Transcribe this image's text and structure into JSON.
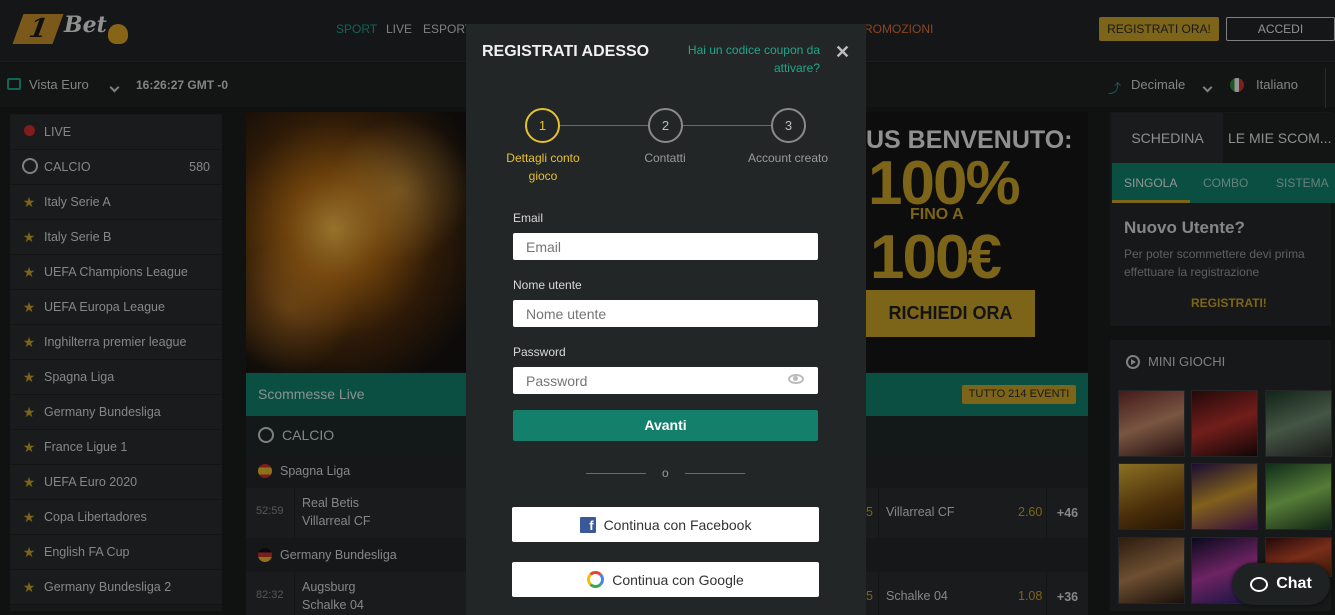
{
  "brand": {
    "logo_one": "1",
    "logo_text": "Bet"
  },
  "nav": {
    "items": [
      "SPORT",
      "LIVE",
      "ESPORTS"
    ],
    "promo": "ROMOZIONI",
    "register": "REGISTRATI ORA!",
    "login": "ACCEDI"
  },
  "subbar": {
    "view": "Vista Euro",
    "time": "16:26:27 GMT -0",
    "odds_format": "Decimale",
    "language": "Italiano"
  },
  "sidebar": {
    "items": [
      {
        "label": "LIVE",
        "icon": "live-dot-icon",
        "count": ""
      },
      {
        "label": "CALCIO",
        "icon": "soccer-ball-icon",
        "count": "580"
      },
      {
        "label": "Italy Serie A",
        "icon": "star-icon"
      },
      {
        "label": "Italy Serie B",
        "icon": "star-icon"
      },
      {
        "label": "UEFA Champions League",
        "icon": "star-icon"
      },
      {
        "label": "UEFA Europa League",
        "icon": "star-icon"
      },
      {
        "label": "Inghilterra premier league",
        "icon": "star-icon"
      },
      {
        "label": "Spagna Liga",
        "icon": "star-icon"
      },
      {
        "label": "Germany Bundesliga",
        "icon": "star-icon"
      },
      {
        "label": "France Ligue 1",
        "icon": "star-icon"
      },
      {
        "label": "UEFA Euro 2020",
        "icon": "star-icon"
      },
      {
        "label": "Copa Libertadores",
        "icon": "star-icon"
      },
      {
        "label": "English FA Cup",
        "icon": "star-icon"
      },
      {
        "label": "Germany Bundesliga 2",
        "icon": "star-icon"
      }
    ]
  },
  "banner": {
    "title": "US BENVENUTO:",
    "big1": "100%",
    "mid": "FINO A",
    "big2": "100€",
    "cta": "RICHIEDI ORA"
  },
  "live": {
    "title": "Scommesse Live",
    "all_events": "TUTTO 214 EVENTI",
    "sport": "CALCIO",
    "groups": [
      {
        "league": "Spagna Liga",
        "match": {
          "time": "52:59",
          "home": "Real Betis",
          "away": "Villarreal CF",
          "cut": "5",
          "right_team": "Villarreal CF",
          "odd": "2.60",
          "more": "+46"
        }
      },
      {
        "league": "Germany Bundesliga",
        "match": {
          "time": "82:32",
          "home": "Augsburg",
          "away": "Schalke 04",
          "cut": "5",
          "right_team": "Schalke 04",
          "odd": "1.08",
          "more": "+36"
        }
      }
    ]
  },
  "betslip": {
    "tab1": "SCHEDINA",
    "tab2": "LE MIE SCOM...",
    "subtabs": [
      "SINGOLA",
      "COMBO",
      "SISTEMA"
    ],
    "title": "Nuovo Utente?",
    "desc": "Per poter scommettere devi prima effettuare la registrazione",
    "register": "REGISTRATI!"
  },
  "minigames": {
    "title": "MINI GIOCHI"
  },
  "chat": {
    "label": "Chat"
  },
  "modal": {
    "title": "REGISTRATI ADESSO",
    "coupon": "Hai un codice coupon da attivare?",
    "close": "✕",
    "steps": [
      {
        "num": "1",
        "label": "Dettagli conto gioco"
      },
      {
        "num": "2",
        "label": "Contatti"
      },
      {
        "num": "3",
        "label": "Account creato"
      }
    ],
    "email_label": "Email",
    "email_placeholder": "Email",
    "username_label": "Nome utente",
    "username_placeholder": "Nome utente",
    "password_label": "Password",
    "password_placeholder": "Password",
    "next": "Avanti",
    "or": "o",
    "facebook": "Continua con Facebook",
    "google": "Continua con Google"
  },
  "colors": {
    "accent": "#12806b",
    "gold": "#c9a227",
    "step_active": "#e6c229"
  }
}
